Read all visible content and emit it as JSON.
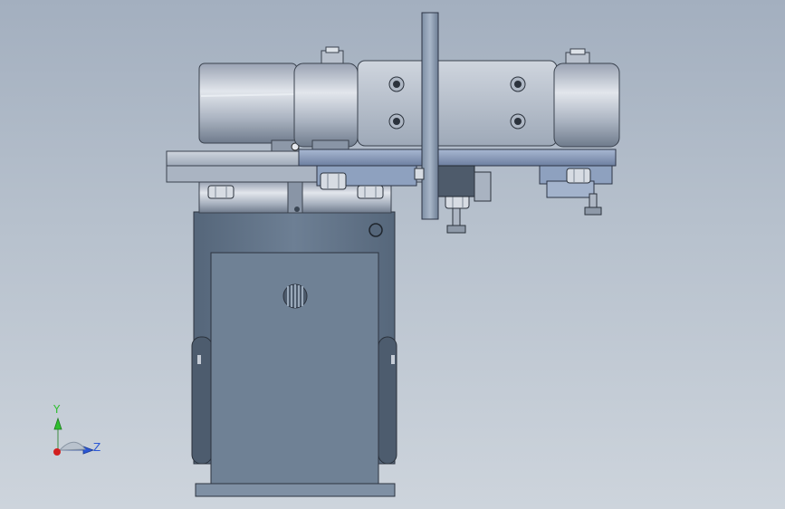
{
  "viewport": {
    "background_top": "#a3afbf",
    "background_bottom": "#cdd4dc"
  },
  "model": {
    "metal_dark": "#5d6f84",
    "metal_mid": "#7e8fa3",
    "metal_light": "#c9d0da",
    "steel_blue": "#8ea1bf"
  },
  "triad": {
    "y_label": "Y",
    "z_label": "Z",
    "y_color": "#2fbf2f",
    "z_color": "#2b57d6",
    "x_color": "#d21f1f"
  }
}
